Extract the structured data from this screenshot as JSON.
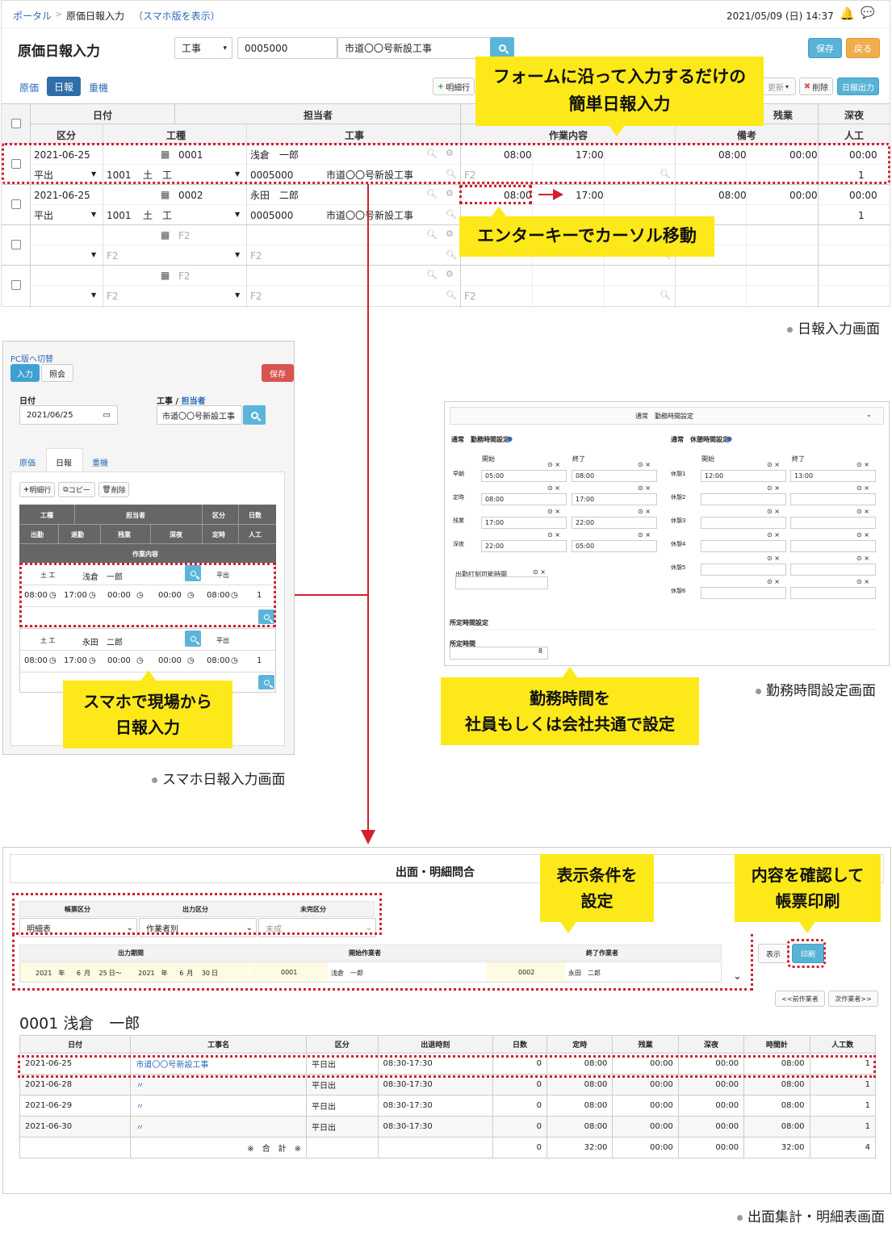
{
  "top": {
    "breadcrumb_portal": "ポータル",
    "breadcrumb_sep": ">",
    "breadcrumb_current": "原価日報入力",
    "mobile_link": "（スマホ版を表示）",
    "datetime": "2021/05/09 (日) 14:37"
  },
  "header": {
    "title": "原価日報入力",
    "type_select": "工事",
    "code": "0005000",
    "name": "市道〇〇号新設工事",
    "save": "保存",
    "back": "戻る"
  },
  "tabs": {
    "genka": "原価",
    "nippo": "日報",
    "juki": "重機"
  },
  "toolbar": {
    "add_row": "明細行",
    "update": "更新",
    "delete": "削除",
    "nippo_out": "日報出力"
  },
  "table": {
    "h1": {
      "date": "日付",
      "tantou": "担当者",
      "zangyo": "残業",
      "shinya": "深夜"
    },
    "h2": {
      "kubun": "区分",
      "koshu": "工種",
      "koji": "工事",
      "sagyo": "作業内容",
      "biko": "備考",
      "ninku": "人工"
    },
    "rows": [
      {
        "date": "2021-06-25",
        "emp_code": "0001",
        "emp_name": "浅倉　一郎",
        "start": "08:00",
        "end": "17:00",
        "teiji": "08:00",
        "zangyo": "00:00",
        "shinya": "00:00",
        "kubun": "平出",
        "koshu_code": "1001",
        "koshu_name": "土　工",
        "koji_code": "0005000",
        "koji_name": "市道〇〇号新設工事",
        "f2": "F2",
        "ninku": "1"
      },
      {
        "date": "2021-06-25",
        "emp_code": "0002",
        "emp_name": "永田　二郎",
        "start": "08:00",
        "end": "17:00",
        "teiji": "08:00",
        "zangyo": "00:00",
        "shinya": "00:00",
        "kubun": "平出",
        "koshu_code": "1001",
        "koshu_name": "土　工",
        "koji_code": "0005000",
        "koji_name": "市道〇〇号新設工事",
        "f2": "F2",
        "ninku": "1"
      }
    ],
    "placeholder": "F2"
  },
  "callouts": {
    "form": "フォームに沿って入力するだけの\n簡単日報入力",
    "enter": "エンターキーでカーソル移動",
    "smartphone": "スマホで現場から\n日報入力",
    "kinmu": "勤務時間を\n社員もしくは会社共通で設定",
    "conditions": "表示条件を\n設定",
    "print": "内容を確認して\n帳票印刷"
  },
  "captions": {
    "nippo": "日報入力画面",
    "kinmu": "勤務時間設定画面",
    "smaho": "スマホ日報入力画面",
    "demen": "出面集計・明細表画面"
  },
  "mobile": {
    "pc_switch": "PC版へ切替",
    "input": "入力",
    "inquiry": "照会",
    "save": "保存",
    "date_label": "日付",
    "date_value": "2021/06/25",
    "koji_label": "工事 /",
    "tanto_label": "担当者",
    "koji_value": "市道〇〇号新設工事",
    "tab_genka": "原価",
    "tab_nippo": "日報",
    "tab_juki": "重機",
    "add_row": "明細行",
    "copy": "コピー",
    "delete": "削除",
    "h1": [
      "工種",
      "担当者",
      "区分",
      "日数"
    ],
    "h2": [
      "出勤",
      "退勤",
      "残業",
      "深夜",
      "定時",
      "人工"
    ],
    "h3": "作業内容",
    "rows": [
      {
        "koshu": "土 工",
        "name": "浅倉　一郎",
        "kubun": "平出",
        "t1": "08:00",
        "t2": "17:00",
        "t3": "00:00",
        "t4": "00:00",
        "t5": "08:00",
        "ninku": "1"
      },
      {
        "koshu": "土 工",
        "name": "永田　二郎",
        "kubun": "平出",
        "t1": "08:00",
        "t2": "17:00",
        "t3": "00:00",
        "t4": "00:00",
        "t5": "08:00",
        "ninku": "1"
      }
    ]
  },
  "kinmu": {
    "title": "通常　勤務時間設定",
    "left_title": "通常　勤務時間設定",
    "right_title": "通常　休憩時間設定",
    "start": "開始",
    "end": "終了",
    "left_rows": [
      {
        "label": "早朝",
        "s": "05:00",
        "e": "08:00"
      },
      {
        "label": "定時",
        "s": "08:00",
        "e": "17:00"
      },
      {
        "label": "残業",
        "s": "17:00",
        "e": "22:00"
      },
      {
        "label": "深夜",
        "s": "22:00",
        "e": "05:00"
      }
    ],
    "right_rows": [
      {
        "label": "休憩1",
        "s": "12:00",
        "e": "13:00"
      },
      {
        "label": "休憩2",
        "s": "",
        "e": ""
      },
      {
        "label": "休憩3",
        "s": "",
        "e": ""
      },
      {
        "label": "休憩4",
        "s": "",
        "e": ""
      },
      {
        "label": "休憩5",
        "s": "",
        "e": ""
      },
      {
        "label": "休憩6",
        "s": "",
        "e": ""
      }
    ],
    "dakoku": "出勤打刻可能時間",
    "shotei_title": "所定時間設定",
    "shotei_label": "所定時間",
    "shotei_value": "8"
  },
  "demen": {
    "title": "出面・明細問合",
    "f_label1": "帳票区分",
    "f_label2": "出力区分",
    "f_label3": "未完区分",
    "f_val1": "明細表",
    "f_val2": "作業者別",
    "f_val3": "未成",
    "p_label1": "出力期間",
    "p_label2": "開始作業者",
    "p_label3": "終了作業者",
    "period": {
      "y1": "2021",
      "m1": "6",
      "d1": "25",
      "y2": "2021",
      "m2": "6",
      "d2": "30",
      "nen": "年",
      "tsuki": "月",
      "hi": "日",
      "tilde": "〜"
    },
    "start_code": "0001",
    "start_name": "浅倉　一郎",
    "end_code": "0002",
    "end_name": "永田　二郎",
    "show": "表示",
    "print": "印刷",
    "prev": "<<前作業者",
    "next": "次作業者>>",
    "worker": "0001 浅倉　一郎",
    "cols": [
      "日付",
      "工事名",
      "区分",
      "出退時刻",
      "日数",
      "定時",
      "残業",
      "深夜",
      "時間計",
      "人工数"
    ],
    "rows": [
      [
        "2021-06-25",
        "市道〇〇号新設工事",
        "平日出",
        "08:30-17:30",
        "0",
        "08:00",
        "00:00",
        "00:00",
        "08:00",
        "1"
      ],
      [
        "2021-06-28",
        "〃",
        "平日出",
        "08:30-17:30",
        "0",
        "08:00",
        "00:00",
        "00:00",
        "08:00",
        "1"
      ],
      [
        "2021-06-29",
        "〃",
        "平日出",
        "08:30-17:30",
        "0",
        "08:00",
        "00:00",
        "00:00",
        "08:00",
        "1"
      ],
      [
        "2021-06-30",
        "〃",
        "平日出",
        "08:30-17:30",
        "0",
        "08:00",
        "00:00",
        "00:00",
        "08:00",
        "1"
      ]
    ],
    "total": [
      "※　合　計　※",
      "0",
      "32:00",
      "00:00",
      "00:00",
      "32:00",
      "4"
    ]
  }
}
